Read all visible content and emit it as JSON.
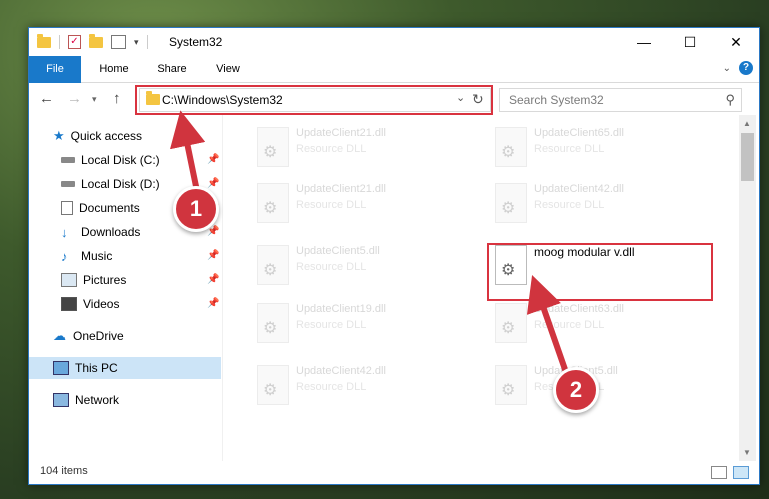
{
  "window": {
    "title": "System32"
  },
  "ribbon": {
    "tabs": [
      "File",
      "Home",
      "Share",
      "View"
    ],
    "help_label": "?"
  },
  "address_bar": {
    "path": "C:\\Windows\\System32"
  },
  "search": {
    "placeholder": "Search System32"
  },
  "sidebar": {
    "items": [
      {
        "label": "Quick access",
        "icon": "star-icon",
        "pinned": false
      },
      {
        "label": "Local Disk (C:)",
        "icon": "drive-icon",
        "pinned": true
      },
      {
        "label": "Local Disk (D:)",
        "icon": "drive-icon",
        "pinned": true
      },
      {
        "label": "Documents",
        "icon": "documents-icon",
        "pinned": true
      },
      {
        "label": "Downloads",
        "icon": "download-icon",
        "pinned": true
      },
      {
        "label": "Music",
        "icon": "music-icon",
        "pinned": true
      },
      {
        "label": "Pictures",
        "icon": "pictures-icon",
        "pinned": true
      },
      {
        "label": "Videos",
        "icon": "videos-icon",
        "pinned": true
      },
      {
        "label": "OneDrive",
        "icon": "cloud-icon",
        "pinned": false
      },
      {
        "label": "This PC",
        "icon": "computer-icon",
        "pinned": false,
        "selected": true
      },
      {
        "label": "Network",
        "icon": "network-icon",
        "pinned": false
      }
    ]
  },
  "files": [
    {
      "name": "UpdateClient21.dll",
      "type": "Resource DLL"
    },
    {
      "name": "UpdateClient65.dll",
      "type": "Resource DLL"
    },
    {
      "name": "UpdateClient21.dll",
      "type": "Resource DLL"
    },
    {
      "name": "UpdateClient42.dll",
      "type": "Resource DLL"
    },
    {
      "name": "UpdateClient5.dll",
      "type": "Resource DLL"
    },
    {
      "name": "moog modular v.dll",
      "type": ""
    },
    {
      "name": "UpdateClient19.dll",
      "type": "Resource DLL"
    },
    {
      "name": "UpdateClient63.dll",
      "type": "Resource DLL"
    },
    {
      "name": "UpdateClient42.dll",
      "type": "Resource DLL"
    },
    {
      "name": "UpdateClient5.dll",
      "type": "Resource DLL"
    }
  ],
  "status": {
    "item_count": "104 items"
  },
  "callouts": [
    "1",
    "2"
  ],
  "colors": {
    "accent": "#1979ca",
    "highlight": "#d9333f",
    "selected": "#cce4f7"
  }
}
